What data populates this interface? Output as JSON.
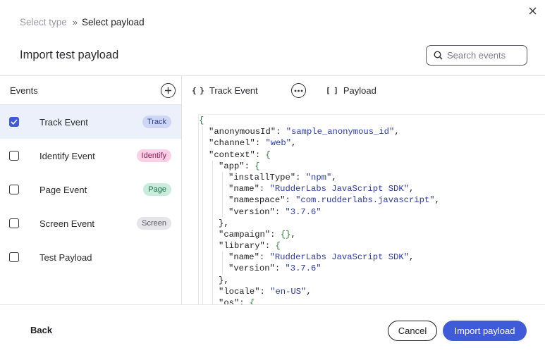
{
  "breadcrumb": {
    "step1": "Select type",
    "separator": "»",
    "step2": "Select payload"
  },
  "dialog": {
    "title": "Import test payload",
    "close_icon": "close-icon"
  },
  "search": {
    "placeholder": "Search events",
    "value": ""
  },
  "events_panel": {
    "header": "Events",
    "items": [
      {
        "label": "Track Event",
        "badge": "Track",
        "checked": true
      },
      {
        "label": "Identify Event",
        "badge": "Identify",
        "checked": false
      },
      {
        "label": "Page Event",
        "badge": "Page",
        "checked": false
      },
      {
        "label": "Screen Event",
        "badge": "Screen",
        "checked": false
      },
      {
        "label": "Test Payload",
        "badge": "",
        "checked": false
      }
    ]
  },
  "tabs": {
    "track": {
      "icon": "{ }",
      "label": "Track Event"
    },
    "payload": {
      "icon": "[ ]",
      "label": "Payload"
    }
  },
  "code": {
    "lines": [
      {
        "indent": 0,
        "text": "{"
      },
      {
        "indent": 1,
        "key": "\"anonymousId\"",
        "value": "\"sample_anonymous_id\"",
        "trail": ","
      },
      {
        "indent": 1,
        "key": "\"channel\"",
        "value": "\"web\"",
        "trail": ","
      },
      {
        "indent": 1,
        "key": "\"context\"",
        "brace": "{"
      },
      {
        "indent": 2,
        "key": "\"app\"",
        "brace": "{"
      },
      {
        "indent": 3,
        "key": "\"installType\"",
        "value": "\"npm\"",
        "trail": ","
      },
      {
        "indent": 3,
        "key": "\"name\"",
        "value": "\"RudderLabs JavaScript SDK\"",
        "trail": ","
      },
      {
        "indent": 3,
        "key": "\"namespace\"",
        "value": "\"com.rudderlabs.javascript\"",
        "trail": ","
      },
      {
        "indent": 3,
        "key": "\"version\"",
        "value": "\"3.7.6\""
      },
      {
        "indent": 2,
        "text": "},"
      },
      {
        "indent": 2,
        "key": "\"campaign\"",
        "brace": "{}",
        "trail": ","
      },
      {
        "indent": 2,
        "key": "\"library\"",
        "brace": "{"
      },
      {
        "indent": 3,
        "key": "\"name\"",
        "value": "\"RudderLabs JavaScript SDK\"",
        "trail": ","
      },
      {
        "indent": 3,
        "key": "\"version\"",
        "value": "\"3.7.6\""
      },
      {
        "indent": 2,
        "text": "},"
      },
      {
        "indent": 2,
        "key": "\"locale\"",
        "value": "\"en-US\"",
        "trail": ","
      },
      {
        "indent": 2,
        "key": "\"os\"",
        "brace": "{"
      }
    ]
  },
  "footer": {
    "back": "Back",
    "cancel": "Cancel",
    "import": "Import payload"
  },
  "colors": {
    "accent": "#3f5bd8",
    "selected_row": "#ecf0fb"
  }
}
